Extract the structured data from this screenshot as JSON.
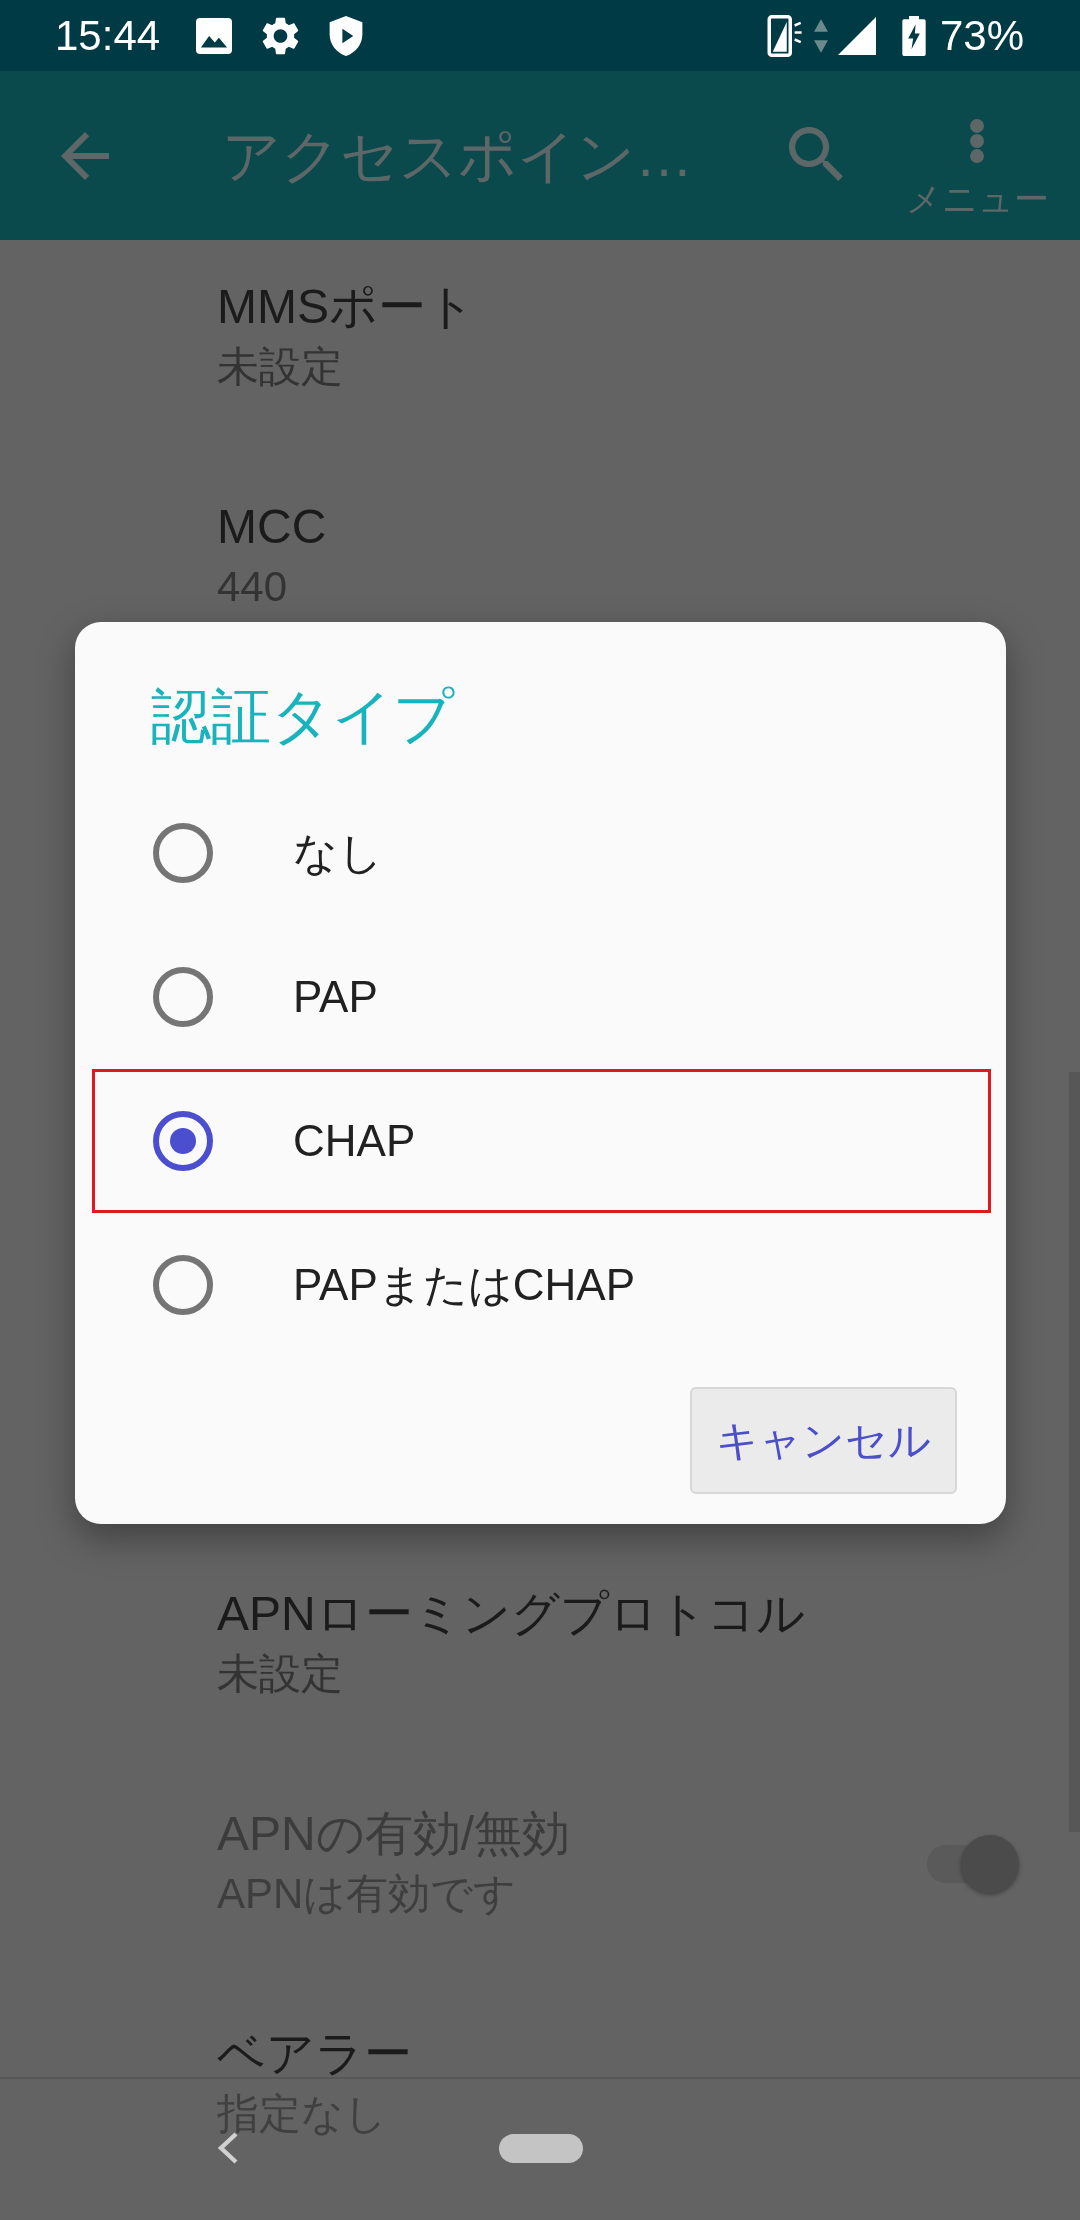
{
  "status_bar": {
    "time": "15:44",
    "battery": "73%"
  },
  "app_bar": {
    "title": "アクセスポイン…",
    "menu_label": "メニュー"
  },
  "settings_above": [
    {
      "kind": "text",
      "title": "MMSポート",
      "summary": "未設定",
      "disabled": false
    },
    {
      "kind": "text",
      "title": "MCC",
      "summary": "440",
      "disabled": false
    }
  ],
  "dialog": {
    "title": "認証タイプ",
    "options": [
      {
        "label": "なし",
        "selected": false,
        "highlighted": false
      },
      {
        "label": "PAP",
        "selected": false,
        "highlighted": false
      },
      {
        "label": "CHAP",
        "selected": true,
        "highlighted": true
      },
      {
        "label": "PAPまたはCHAP",
        "selected": false,
        "highlighted": false
      }
    ],
    "buttons": [
      "キャンセル"
    ]
  },
  "settings_below": [
    {
      "kind": "text",
      "title": "APNローミングプロトコル",
      "summary": "未設定",
      "disabled": false
    },
    {
      "kind": "switch",
      "title": "APNの有効/無効",
      "summary": "APNは有効です",
      "disabled": true,
      "on": true
    },
    {
      "kind": "text",
      "title": "ベアラー",
      "summary": "指定なし",
      "disabled": false
    }
  ]
}
